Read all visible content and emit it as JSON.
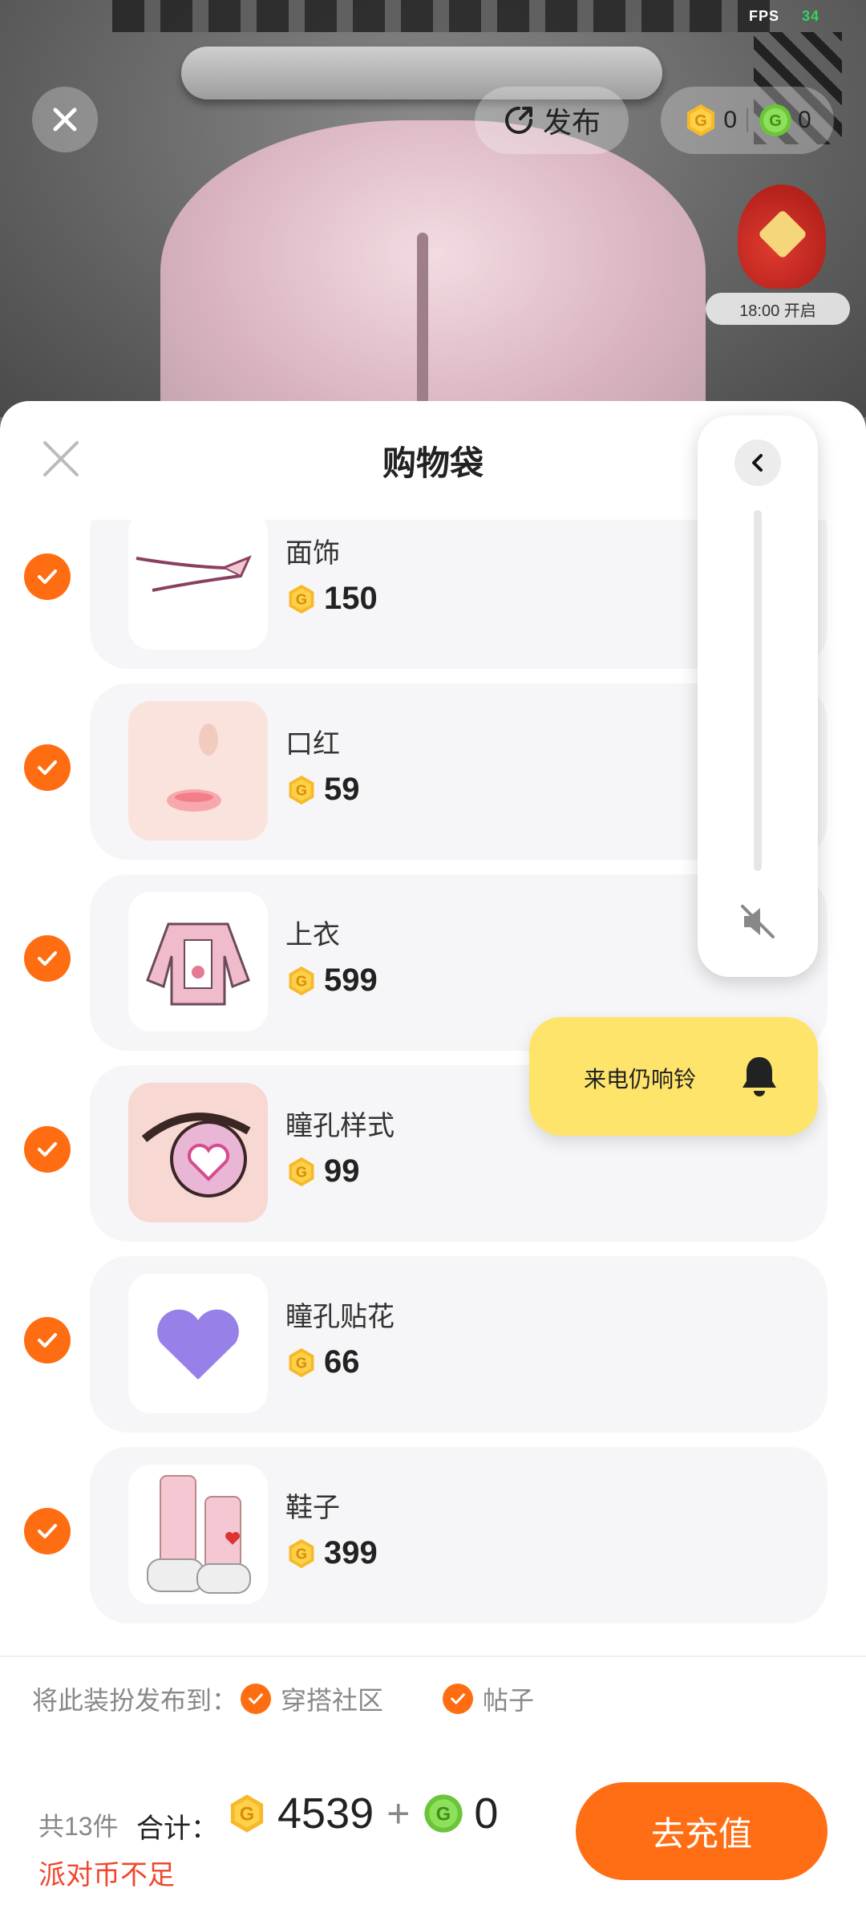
{
  "hud": {
    "fps_label": "FPS",
    "fps_value": "34"
  },
  "top": {
    "publish_label": "发布",
    "gold_balance": "0",
    "green_balance": "0"
  },
  "event": {
    "time_label": "18:00 开启"
  },
  "sheet": {
    "title": "购物袋"
  },
  "items": [
    {
      "name": "面饰",
      "price": "150",
      "checked": true,
      "thumb": "face-accessory"
    },
    {
      "name": "口红",
      "price": "59",
      "checked": true,
      "thumb": "lipstick"
    },
    {
      "name": "上衣",
      "price": "599",
      "checked": true,
      "thumb": "top-garment"
    },
    {
      "name": "瞳孔样式",
      "price": "99",
      "checked": true,
      "thumb": "pupil-style"
    },
    {
      "name": "瞳孔贴花",
      "price": "66",
      "checked": true,
      "thumb": "pupil-decal"
    },
    {
      "name": "鞋子",
      "price": "399",
      "checked": true,
      "thumb": "shoes"
    }
  ],
  "volume_panel": {
    "ring_label": "来电仍响铃"
  },
  "publish_to": {
    "label": "将此装扮发布到：",
    "options": [
      {
        "label": "穿搭社区",
        "checked": true
      },
      {
        "label": "帖子",
        "checked": true
      }
    ]
  },
  "footer": {
    "count_text": "共13件",
    "total_label": "合计：",
    "gold_total": "4539",
    "plus": "+",
    "green_total": "0",
    "warning": "派对币不足",
    "recharge_label": "去充值"
  },
  "colors": {
    "accent": "#ff6e14",
    "warning": "#f0472e",
    "ring_bg": "#fee46a",
    "gold_coin": "#f7b928",
    "green_coin": "#6ac53a"
  }
}
